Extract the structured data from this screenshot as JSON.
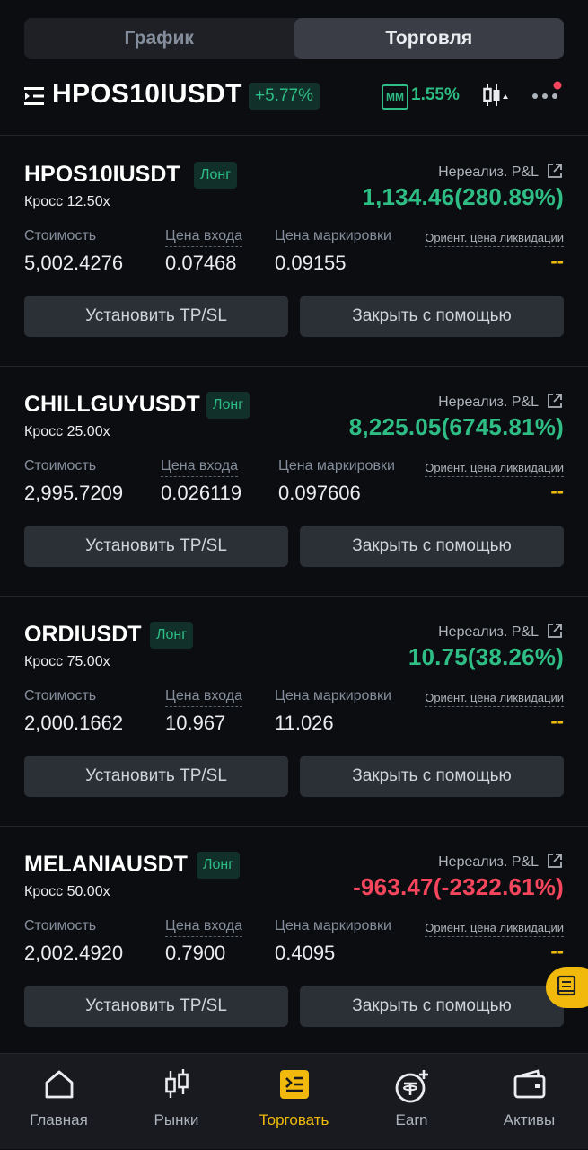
{
  "tabs": [
    {
      "label": "График",
      "active": false
    },
    {
      "label": "Торговля",
      "active": true
    }
  ],
  "header": {
    "symbol": "HPOS10IUSDT",
    "change": "+5.77%",
    "mm_label": "MM",
    "mm_value": "1.55%"
  },
  "labels": {
    "pnl": "Нереализ. P&L",
    "value": "Стоимость",
    "entry": "Цена входа",
    "mark": "Цена маркировки",
    "liq": "Ориент. цена ликвидации",
    "tpsl": "Установить TP/SL",
    "close": "Закрыть с помощью"
  },
  "positions": [
    {
      "symbol": "HPOS10IUSDT",
      "side": "Лонг",
      "leverage": "Кросс 12.50x",
      "pnl": "1,134.46(280.89%)",
      "pnl_sign": "positive",
      "value": "5,002.4276",
      "entry": "0.07468",
      "mark": "0.09155",
      "liq": "--"
    },
    {
      "symbol": "CHILLGUYUSDT",
      "side": "Лонг",
      "leverage": "Кросс 25.00x",
      "pnl": "8,225.05(6745.81%)",
      "pnl_sign": "positive",
      "value": "2,995.7209",
      "entry": "0.026119",
      "mark": "0.097606",
      "liq": "--"
    },
    {
      "symbol": "ORDIUSDT",
      "side": "Лонг",
      "leverage": "Кросс 75.00x",
      "pnl": "10.75(38.26%)",
      "pnl_sign": "positive",
      "value": "2,000.1662",
      "entry": "10.967",
      "mark": "11.026",
      "liq": "--"
    },
    {
      "symbol": "MELANIAUSDT",
      "side": "Лонг",
      "leverage": "Кросс 50.00x",
      "pnl": "-963.47(-2322.61%)",
      "pnl_sign": "negative",
      "value": "2,002.4920",
      "entry": "0.7900",
      "mark": "0.4095",
      "liq": "--"
    }
  ],
  "nav": [
    {
      "label": "Главная",
      "icon": "home-icon",
      "active": false
    },
    {
      "label": "Рынки",
      "icon": "markets-candles-icon",
      "active": false
    },
    {
      "label": "Торговать",
      "icon": "trade-icon",
      "active": true
    },
    {
      "label": "Earn",
      "icon": "earn-coin-icon",
      "active": false
    },
    {
      "label": "Активы",
      "icon": "wallet-icon",
      "active": false
    }
  ],
  "colors": {
    "positive": "#2ebd85",
    "negative": "#f6465d",
    "accent": "#f0b90b"
  }
}
